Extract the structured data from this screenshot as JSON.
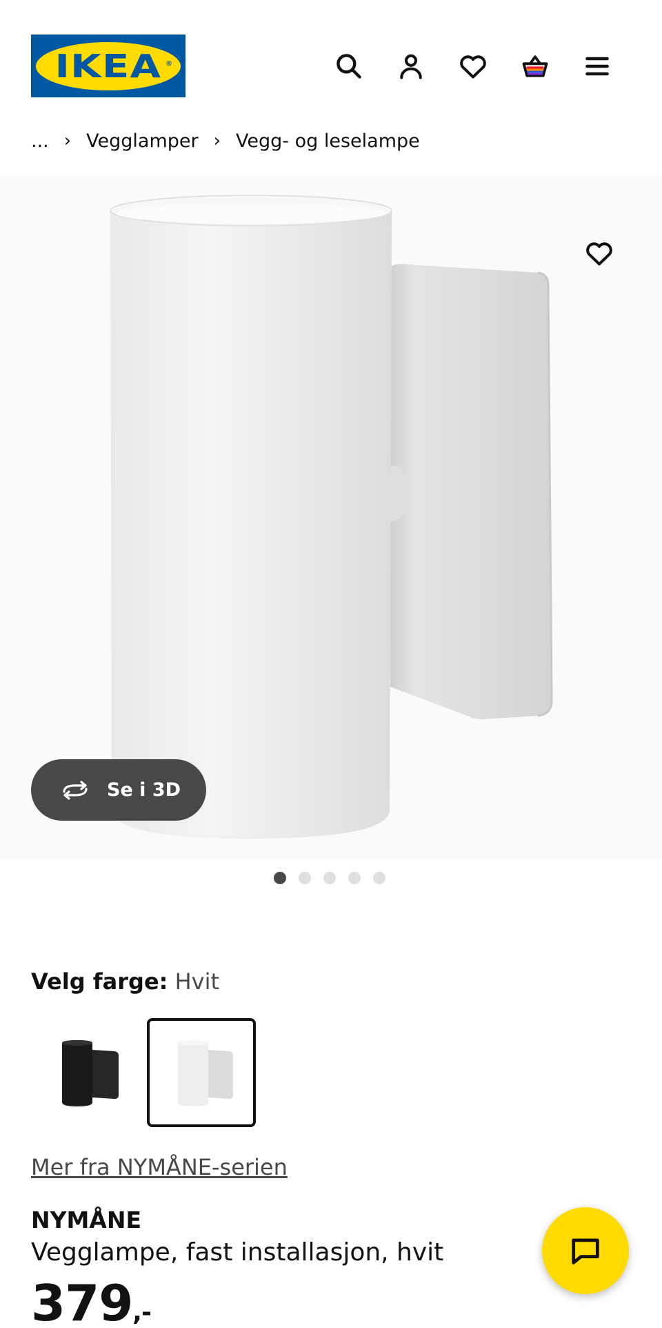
{
  "header": {
    "logo_text": "IKEA",
    "logo_reg": "®",
    "icons": [
      "search-icon",
      "account-icon",
      "heart-icon",
      "basket-icon",
      "menu-icon"
    ],
    "brand_blue": "#0058a3",
    "brand_yellow": "#ffdb00"
  },
  "breadcrumb": {
    "ellipsis": "...",
    "separator": "›",
    "items": [
      "Vegglamper",
      "Vegg- og leselampe"
    ]
  },
  "gallery": {
    "see_3d_label": "Se i 3D",
    "active_dot": 1,
    "dot_count": 5
  },
  "color": {
    "label": "Velg farge:",
    "value": "Hvit",
    "options": [
      "black",
      "white"
    ],
    "selected": "white"
  },
  "series_link": "Mer fra NYMÅNE-serien",
  "product": {
    "name": "NYMÅNE",
    "description": "Vegglampe, fast installasjon, hvit",
    "price": "379",
    "price_suffix": ",-"
  }
}
